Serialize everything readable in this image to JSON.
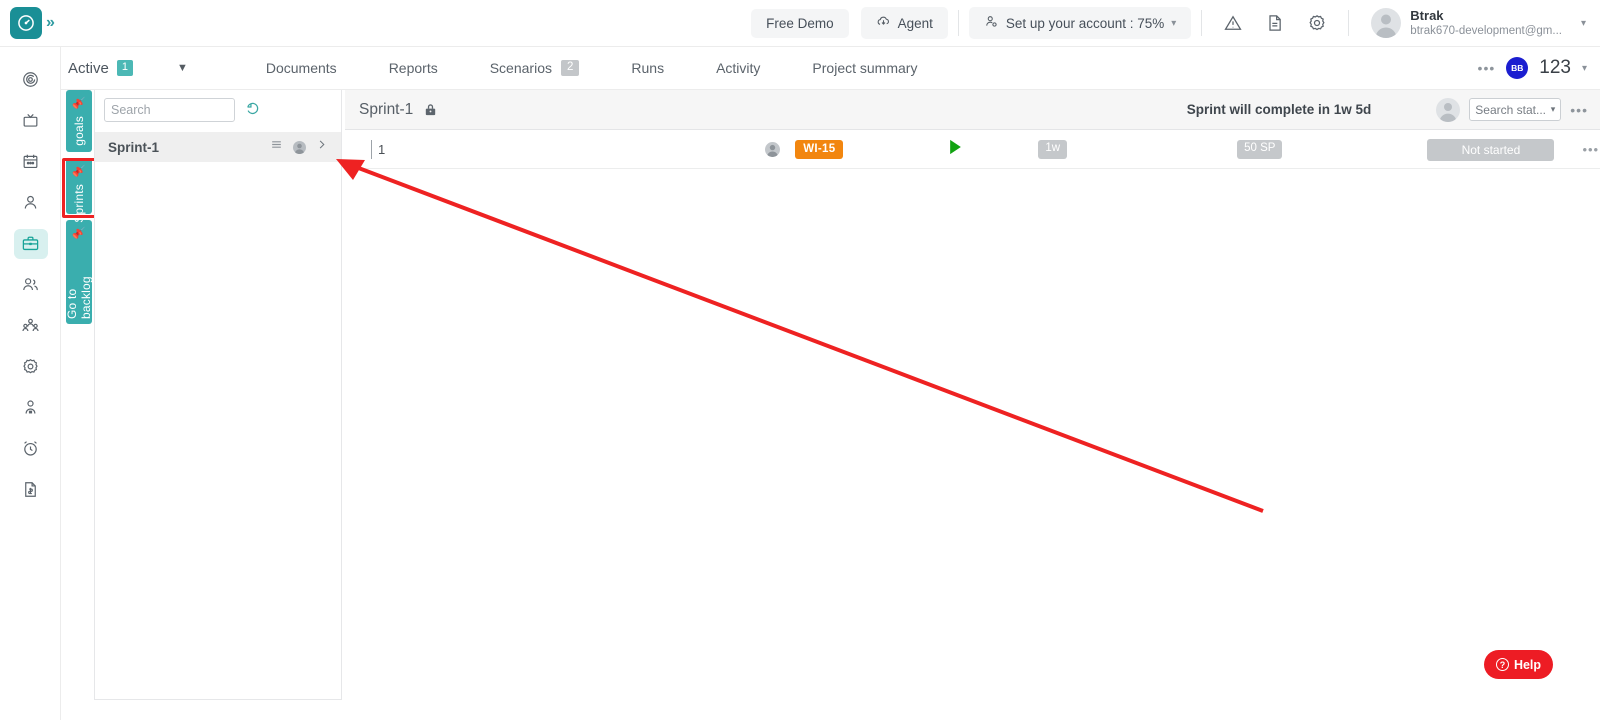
{
  "topbar": {
    "logo_icon": "clock-target-logo",
    "expand_icon": "chevrons-right-icon",
    "free_demo_label": "Free Demo",
    "agent_label": "Agent",
    "agent_icon": "cloud-download-icon",
    "account_setup_label": "Set up your account : 75%",
    "account_setup_icon": "user-gear-icon",
    "account_caret": "▾",
    "warning_icon": "warning-triangle-icon",
    "doc_icon": "document-icon",
    "settings_icon": "gear-icon",
    "profile_name": "Btrak",
    "profile_email": "btrak670-development@gm...",
    "profile_caret": "▾"
  },
  "rail": {
    "items": [
      {
        "icon": "target-spiral-icon",
        "active": false
      },
      {
        "icon": "monitor-tv-icon",
        "active": false
      },
      {
        "icon": "calendar-icon",
        "active": false
      },
      {
        "icon": "user-icon",
        "active": false
      },
      {
        "icon": "briefcase-icon",
        "active": true
      },
      {
        "icon": "users-group-icon",
        "active": false
      },
      {
        "icon": "team-org-icon",
        "active": false
      },
      {
        "icon": "gear-icon",
        "active": false
      },
      {
        "icon": "user-badge-icon",
        "active": false
      },
      {
        "icon": "alarm-clock-icon",
        "active": false
      },
      {
        "icon": "invoice-dollar-icon",
        "active": false
      }
    ]
  },
  "tabstrip": {
    "active_label": "Active",
    "active_count": "1",
    "dropdown_caret": "▼",
    "tabs": [
      {
        "label": "Documents",
        "count": ""
      },
      {
        "label": "Reports",
        "count": ""
      },
      {
        "label": "Scenarios",
        "count": "2"
      },
      {
        "label": "Runs",
        "count": ""
      },
      {
        "label": "Activity",
        "count": ""
      },
      {
        "label": "Project summary",
        "count": ""
      }
    ],
    "more_dots": "•••",
    "avatar_initials": "BB",
    "count_number": "123",
    "count_caret": "▾"
  },
  "vtabs": [
    {
      "label": "goals",
      "icon": "pin-icon",
      "name": "vtab-goals"
    },
    {
      "label": "Sprints",
      "icon": "pin-icon",
      "name": "vtab-sprints"
    },
    {
      "label": "Go to backlog",
      "icon": "pin-icon",
      "name": "vtab-backlog"
    }
  ],
  "sprint_panel": {
    "search_placeholder": "Search",
    "search_value": "",
    "refresh_icon": "refresh-undo-icon",
    "rows": [
      {
        "name": "Sprint-1",
        "menu_icon": "hamburger-icon",
        "avatar_icon": "user-avatar-icon",
        "chevron_icon": "chevron-right-icon"
      }
    ]
  },
  "main_header": {
    "sprint_title": "Sprint-1",
    "lock_icon": "lock-icon",
    "completion_text": "Sprint will complete in 1w 5d",
    "avatar_icon": "user-avatar-icon",
    "status_filter_value": "Search stat...",
    "status_filter_caret": "▾",
    "more_dots": "•••"
  },
  "work_items": [
    {
      "title": "1",
      "avatar_icon": "user-avatar-icon",
      "id_badge": "WI-15",
      "id_badge_color": "#f2860f",
      "play_icon": "play-triangle-icon",
      "play_color": "#12a312",
      "duration": "1w",
      "story_points": "50 SP",
      "status": "Not started",
      "status_color": "#c5c8cb",
      "row_more_dots": "•••"
    }
  ],
  "help": {
    "label": "Help",
    "icon": "question-circle-icon",
    "color": "#ed1c24"
  },
  "annotation": {
    "arrow_color": "#ee2222",
    "highlight_color": "#ee2222",
    "highlight_target": "vtab-sprints"
  }
}
